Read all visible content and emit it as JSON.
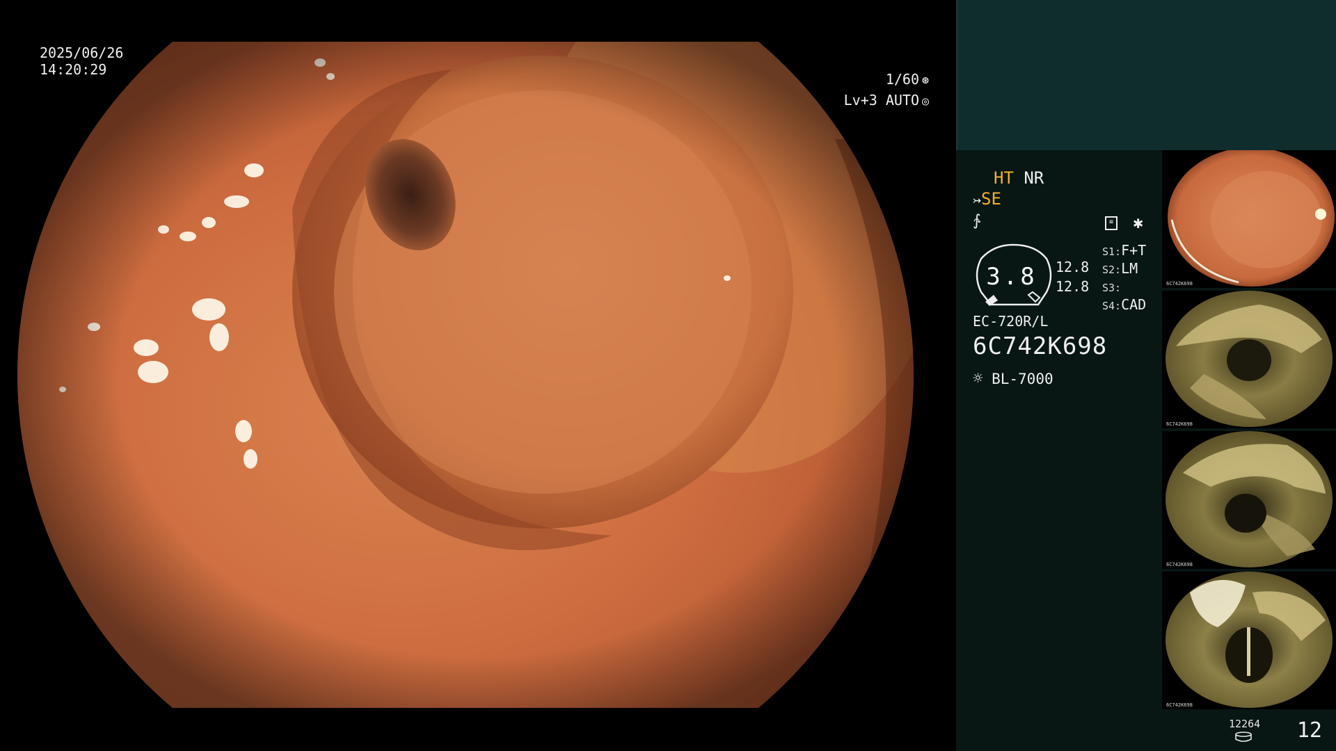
{
  "overlay": {
    "date": "2025/06/26",
    "time": "14:20:29",
    "shutter": "1/60",
    "level": "Lv+3 AUTO"
  },
  "settings": {
    "ht": "HT",
    "nr": "NR",
    "se": "SE",
    "histogram_value": "3.8",
    "hist_top": "12.8",
    "hist_bottom": "12.8",
    "slots": [
      {
        "key": "S1:",
        "value": "F+T"
      },
      {
        "key": "S2:",
        "value": "LM"
      },
      {
        "key": "S3:",
        "value": ""
      },
      {
        "key": "S4:",
        "value": "CAD"
      }
    ],
    "scope_model": "EC-720R/L",
    "scope_serial": "6C742K698",
    "light_source": "BL-7000"
  },
  "icons": {
    "shutter": "aperture-icon",
    "auto": "iris-icon",
    "se": "scope-arrow-icon",
    "f": "frequency-icon",
    "memo": "memo-icon",
    "star": "asterisk-icon",
    "light": "sun-icon",
    "db": "storage-icon"
  },
  "thumbnails": [
    {
      "serial": "6C742K698",
      "tone": "orange"
    },
    {
      "serial": "6C742K698",
      "tone": "olive"
    },
    {
      "serial": "6C742K698",
      "tone": "olive"
    },
    {
      "serial": "6C742K698",
      "tone": "olive"
    }
  ],
  "footer": {
    "record_id": "12264",
    "image_count": "12"
  },
  "colors": {
    "panel_bg": "#081614",
    "panel_top": "#0f2d2c",
    "accent_orange": "#f4b02a",
    "tissue": "#c8653c"
  }
}
